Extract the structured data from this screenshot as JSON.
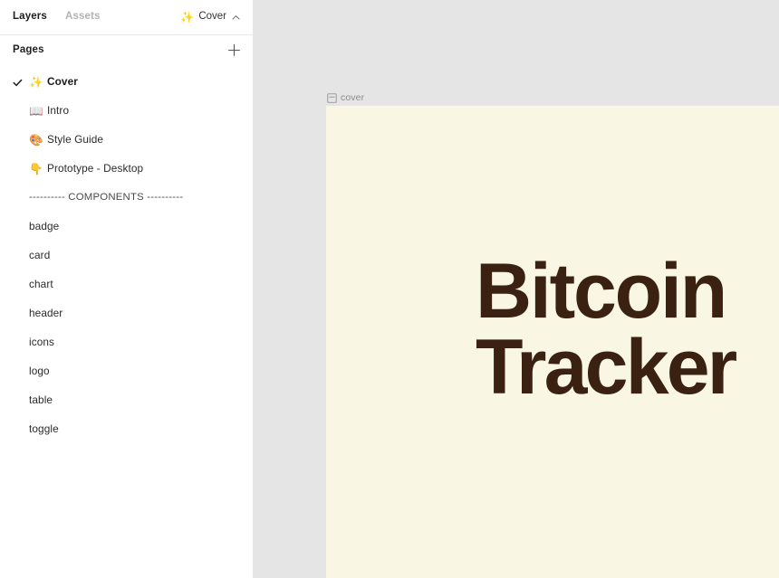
{
  "sidebar": {
    "tabs": [
      {
        "label": "Layers",
        "active": true
      },
      {
        "label": "Assets",
        "active": false
      }
    ],
    "current_page": {
      "emoji": "✨",
      "icon_name": "sparkles-icon",
      "label": "Cover",
      "caret": "chevron-up-icon"
    },
    "pages_section": {
      "title": "Pages",
      "add_button_icon": "plus-icon"
    },
    "pages": [
      {
        "label": "Cover",
        "emoji": "✨",
        "icon_name": "sparkles-icon",
        "selected": true
      },
      {
        "label": "Intro",
        "emoji": "📖",
        "icon_name": "open-book-icon",
        "selected": false
      },
      {
        "label": "Style Guide",
        "emoji": "🎨",
        "icon_name": "artist-palette-icon",
        "selected": false
      },
      {
        "label": "Prototype - Desktop",
        "emoji": "👇",
        "icon_name": "point-down-icon",
        "selected": false
      },
      {
        "label": "---------- COMPONENTS ----------",
        "emoji": "",
        "icon_name": "",
        "selected": false,
        "divider": true
      },
      {
        "label": "badge",
        "emoji": "",
        "icon_name": "",
        "selected": false
      },
      {
        "label": "card",
        "emoji": "",
        "icon_name": "",
        "selected": false
      },
      {
        "label": "chart",
        "emoji": "",
        "icon_name": "",
        "selected": false
      },
      {
        "label": "header",
        "emoji": "",
        "icon_name": "",
        "selected": false
      },
      {
        "label": "icons",
        "emoji": "",
        "icon_name": "",
        "selected": false
      },
      {
        "label": "logo",
        "emoji": "",
        "icon_name": "",
        "selected": false
      },
      {
        "label": "table",
        "emoji": "",
        "icon_name": "",
        "selected": false
      },
      {
        "label": "toggle",
        "emoji": "",
        "icon_name": "",
        "selected": false
      }
    ]
  },
  "canvas": {
    "frame": {
      "label": "cover",
      "icon_name": "frame-icon",
      "title_line_1": "Bitcoin",
      "title_line_2": "Tracker",
      "background_color": "#faf6e4",
      "title_color": "#3b2112"
    },
    "background_color": "#e5e5e5"
  },
  "colors": {
    "sidebar_bg": "#ffffff",
    "canvas_bg": "#e5e5e5",
    "frame_bg": "#faf6e4",
    "title_text": "#3b2112",
    "active_tab": "#1c1c1c",
    "inactive_tab": "#b2b2b2",
    "label_text": "#2b2b2b",
    "frame_label_text": "#8c8c8c"
  }
}
